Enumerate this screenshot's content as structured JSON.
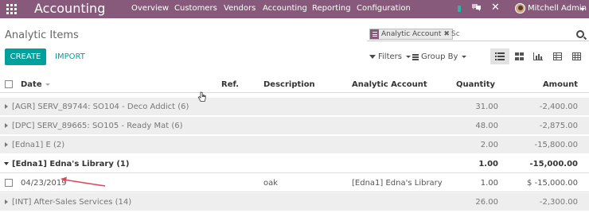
{
  "navbar": {
    "app_name": "Accounting",
    "menu": [
      "Overview",
      "Customers",
      "Vendors",
      "Accounting",
      "Reporting",
      "Configuration"
    ],
    "user_name": "Mitchell Admin",
    "color": "#875a7b"
  },
  "control_panel": {
    "title": "Analytic Items",
    "search": {
      "facet_label": "Analytic Account",
      "input_value": "Sc"
    },
    "create_label": "CREATE",
    "import_label": "IMPORT",
    "filters_label": "Filters",
    "group_by_label": "Group By",
    "accent_color": "#00a09d"
  },
  "table": {
    "columns": {
      "date": "Date",
      "ref": "Ref.",
      "description": "Description",
      "analytic_account": "Analytic Account",
      "quantity": "Quantity",
      "amount": "Amount"
    },
    "groups": [
      {
        "label": "[AGR] SERV_89744: SO104 - Deco Addict (6)",
        "quantity": "31.00",
        "amount": "-2,400.00",
        "expanded": false
      },
      {
        "label": "[DPC] SERV_89665: SO105 - Ready Mat (6)",
        "quantity": "48.00",
        "amount": "-2,875.00",
        "expanded": false
      },
      {
        "label": "[Edna1] E (2)",
        "quantity": "2.00",
        "amount": "-15,800.00",
        "expanded": false
      },
      {
        "label": "[Edna1] Edna's Library (1)",
        "quantity": "1.00",
        "amount": "-15,000.00",
        "expanded": true
      },
      {
        "label": "[INT] After-Sales Services (14)",
        "quantity": "26.00",
        "amount": "-2,300.00",
        "expanded": false
      }
    ],
    "record": {
      "date": "04/23/2019",
      "ref": "",
      "description": "oak",
      "analytic_account": "[Edna1] Edna's Library",
      "quantity": "1.00",
      "amount": "$ -15,000.00"
    }
  }
}
